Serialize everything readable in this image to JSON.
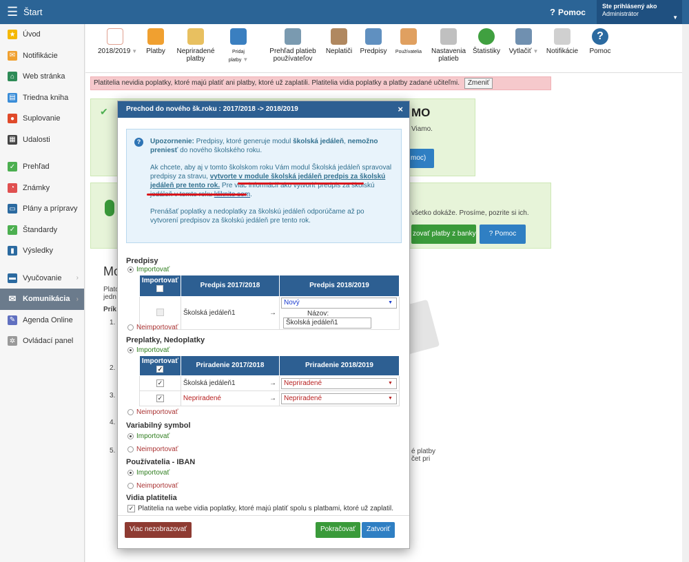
{
  "topbar": {
    "title": "Štart",
    "help": "Pomoc",
    "help_icon": "?",
    "user_line1": "Ste prihlásený ako",
    "user_line2": "Administrátor"
  },
  "sidebar": [
    {
      "label": "Úvod",
      "icon": "star-icon",
      "color": "#f5b800"
    },
    {
      "label": "Notifikácie",
      "icon": "envelope-icon",
      "color": "#f0a030"
    },
    {
      "label": "Web stránka",
      "icon": "home-icon",
      "color": "#2e8b57"
    },
    {
      "label": "Triedna kniha",
      "icon": "book-icon",
      "color": "#3a8dd8"
    },
    {
      "label": "Suplovanie",
      "icon": "person-icon",
      "color": "#e04a2a"
    },
    {
      "label": "Udalosti",
      "icon": "calendar-icon",
      "color": "#444444"
    },
    {
      "label": "Prehľad",
      "icon": "check-circle-icon",
      "color": "#4caf50"
    },
    {
      "label": "Známky",
      "icon": "chart-icon",
      "color": "#e05050"
    },
    {
      "label": "Plány a prípravy",
      "icon": "board-icon",
      "color": "#2b6aa0"
    },
    {
      "label": "Štandardy",
      "icon": "shield-icon",
      "color": "#4caf50"
    },
    {
      "label": "Výsledky",
      "icon": "bar-chart-icon",
      "color": "#2b6aa0"
    },
    {
      "label": "Vyučovanie",
      "icon": "briefcase-icon",
      "color": "#2b6aa0"
    },
    {
      "label": "Komunikácia",
      "icon": "chat-icon",
      "color": "#ffffff"
    },
    {
      "label": "Agenda Online",
      "icon": "pen-icon",
      "color": "#6070c0"
    },
    {
      "label": "Ovládací panel",
      "icon": "gear-icon",
      "color": "#999999"
    }
  ],
  "toolbar": [
    {
      "label": "2018/2019",
      "icon": "calendar-icon",
      "color": "#f5d3c2"
    },
    {
      "label": "Platby",
      "icon": "globe-icon",
      "color": "#f0a030"
    },
    {
      "label": "Nepriradené platby",
      "icon": "question-coins-icon",
      "color": "#e8c060"
    },
    {
      "label": "Pridaj platby",
      "icon": "add-payment-icon",
      "color": "#3a7fc0"
    },
    {
      "label": "Prehľad platieb používateľov",
      "icon": "box-icon",
      "color": "#7a9ab0"
    },
    {
      "label": "Neplatiči",
      "icon": "moneybag-icon",
      "color": "#b08860"
    },
    {
      "label": "Predpisy",
      "icon": "notebook-icon",
      "color": "#6090c0"
    },
    {
      "label": "Používatelia",
      "icon": "users-icon",
      "color": "#e0a060"
    },
    {
      "label": "Nastavenia platieb",
      "icon": "gear-icon",
      "color": "#c0c0c0"
    },
    {
      "label": "Štatistiky",
      "icon": "pie-icon",
      "color": "#40a040"
    },
    {
      "label": "Vytlačiť",
      "icon": "printer-icon",
      "color": "#7090b0"
    },
    {
      "label": "Notifikácie",
      "icon": "phone-icon",
      "color": "#d0d0d0"
    },
    {
      "label": "Pomoc",
      "icon": "help-icon",
      "color": "#2b6aa0"
    }
  ],
  "banner": {
    "text": "Platitelia nevidia poplatky, ktoré majú platiť ani platby, ktoré už zaplatili. Platitelia vidia poplatky a platby zadané učiteľmi.",
    "button": "Zmeniť"
  },
  "background": {
    "mo": "MO",
    "viamo": "Viamo.",
    "moc": "moc)",
    "vsetko": "všetko dokáže. Prosíme, pozrite si ich.",
    "import_btn": "zovať platby z banky",
    "pomoc_btn": "Pomoc",
    "heading": "Mo",
    "plat": "Plato",
    "jedn": "jedn",
    "prik": "Prík",
    "n1": "1.",
    "n2": "2.",
    "n3": "3.",
    "n4": "4.",
    "n5": "5.",
    "eplatby": "é platby",
    "ocet": "čet pri"
  },
  "modal": {
    "title": "Prechod do nového šk.roku : 2017/2018 -> 2018/2019",
    "close": "×",
    "alert": {
      "p1_label": "Upozornenie:",
      "p1_text": " Predpisy, ktoré generuje modul ",
      "p1_bold1": "školská jedáleň",
      "p1_text2": ", ",
      "p1_bold2": "nemožno preniesť",
      "p1_text3": " do nového školského roku.",
      "p2_text": "Ak chcete, aby aj v tomto školskom roku Vám modul Školská jedáleň spravoval predpisy za stravu, ",
      "p2_bold": "vytvorte v module školská jedáleň predpis za školskú jedáleň pre tento rok.",
      "p2_text2": " Pre viac informácií ako vytvoriť predpis za školskú jedáleň v tomto roku ",
      "p2_link": "kliknite sem",
      "p3_text": "Prenášať poplatky a nedoplatky za školskú jedáleň odporúčame až po vytvorení predpisov za školskú jedáleň pre tento rok."
    },
    "predpisy": {
      "title": "Predpisy",
      "import": "Importovať",
      "noimport": "Neimportovať",
      "h_import": "Importovať",
      "h_col1": "Predpis 2017/2018",
      "h_col2": "Predpis 2018/2019",
      "row_name": "Školská jedáleň1",
      "arrow": "→",
      "select": "Nový",
      "name_label": "Názov:",
      "name_value": "Školská jedáleň1"
    },
    "preplatky": {
      "title": "Preplatky, Nedoplatky",
      "import": "Importovať",
      "noimport": "Neimportovať",
      "h_import": "Importovať",
      "h_col1": "Priradenie 2017/2018",
      "h_col2": "Priradenie 2018/2019",
      "rows": [
        {
          "name": "Školská jedáleň1",
          "arrow": "→",
          "select": "Nepriradené"
        },
        {
          "name": "Nepriradené",
          "arrow": "→",
          "select": "Nepriradené"
        }
      ]
    },
    "vs": {
      "title": "Variabilný symbol",
      "import": "Importovať",
      "noimport": "Neimportovať"
    },
    "iban": {
      "title": "Používatelia - IBAN",
      "import": "Importovať",
      "noimport": "Neimportovať"
    },
    "vidia": {
      "title": "Vidia platitelia",
      "text": "Platitelia na webe vidia poplatky, ktoré majú platiť spolu s platbami, ktoré už zaplatil."
    },
    "buttons": {
      "hide": "Viac nezobrazovať",
      "continue": "Pokračovať",
      "close": "Zatvoriť"
    }
  },
  "colors": {
    "topbar": "#2b6496",
    "header": "#2d5f92",
    "green": "#3a9a3a",
    "brown": "#8e3b32",
    "blue": "#2f7fc3"
  }
}
